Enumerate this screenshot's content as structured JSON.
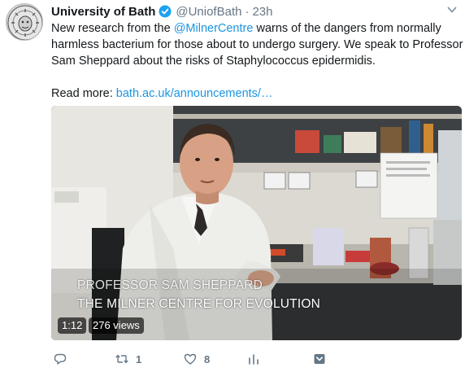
{
  "account": {
    "name": "University of Bath",
    "handle": "@UniofBath",
    "separator": "·",
    "time": "23h"
  },
  "tweet": {
    "line1_pre": "New research from the ",
    "mention": "@MilnerCentre",
    "line1_post": " warns of the dangers from normally",
    "line2": "harmless bacterium for those about to undergo surgery. We speak to Professor",
    "line3": "Sam Sheppard about the risks of Staphylococcus epidermidis.",
    "read_more_label": "Read more: ",
    "read_more_link": "bath.ac.uk/announcements/…"
  },
  "video": {
    "caption_line1": "PROFESSOR SAM SHEPPARD",
    "caption_line2": "THE MILNER CENTRE FOR EVOLUTION",
    "duration": "1:12",
    "views": "276 views"
  },
  "actions": {
    "reply_count": "",
    "retweet_count": "1",
    "like_count": "8"
  },
  "colors": {
    "link": "#1b95e0",
    "muted": "#657786",
    "verified": "#1da1f2"
  },
  "icons": [
    "verified-badge-icon",
    "chevron-down-icon",
    "reply-icon",
    "retweet-icon",
    "like-icon",
    "analytics-icon",
    "bookmark-icon"
  ]
}
